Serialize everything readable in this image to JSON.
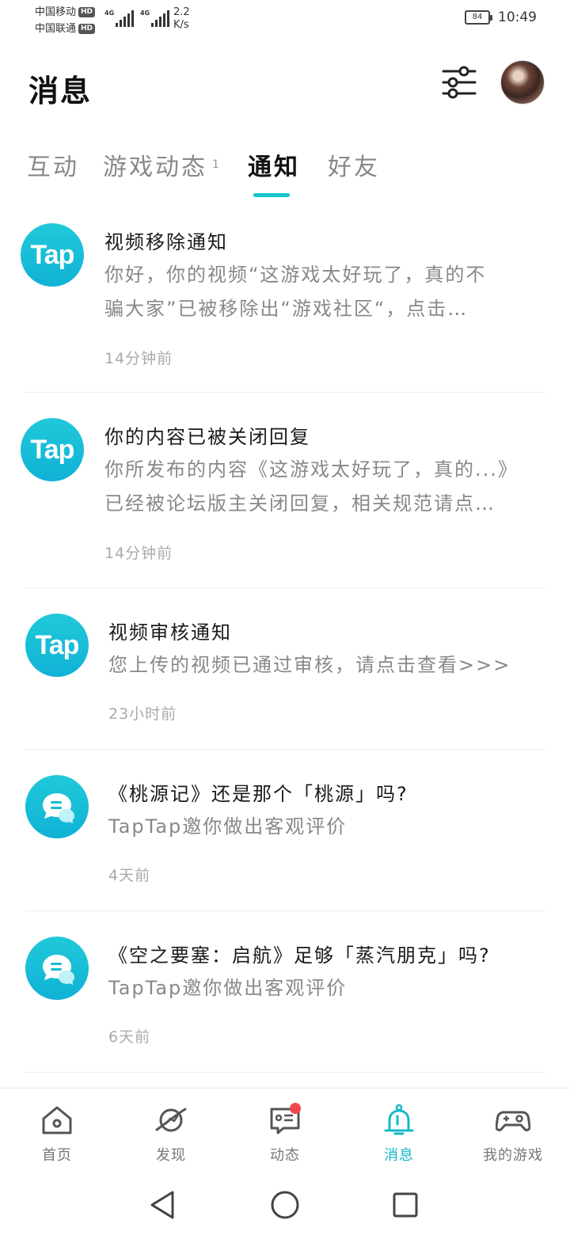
{
  "status_bar": {
    "carrier1": "中国移动",
    "carrier2": "中国联通",
    "hd": "HD",
    "net1": "4G",
    "net2": "4G",
    "speed_value": "2.2",
    "speed_unit": "K/s",
    "battery": "84",
    "time": "10:49"
  },
  "header": {
    "title": "消息",
    "filter_icon": "sliders-icon",
    "avatar": "user-avatar"
  },
  "tabs": [
    {
      "label": "互动",
      "active": false
    },
    {
      "label": "游戏动态",
      "active": false,
      "badge": "1"
    },
    {
      "label": "通知",
      "active": true
    },
    {
      "label": "好友",
      "active": false
    }
  ],
  "notifications": [
    {
      "icon": "tap-logo",
      "icon_text": "Tap",
      "title": "视频移除通知",
      "body_lines": [
        "你好，你的视频“这游戏太好玩了，真的不",
        "骗大家”已被移除出“游戏社区“，点击…"
      ],
      "time": "14分钟前"
    },
    {
      "icon": "tap-logo",
      "icon_text": "Tap",
      "title": "你的内容已被关闭回复",
      "body_lines": [
        "你所发布的内容《这游戏太好玩了，真的...》",
        "已经被论坛版主关闭回复，相关规范请点…"
      ],
      "time": "14分钟前"
    },
    {
      "icon": "tap-logo",
      "icon_text": "Tap",
      "title": "视频审核通知",
      "body_lines": [
        "您上传的视频已通过审核，请点击查看>>>"
      ],
      "time": "23小时前"
    },
    {
      "icon": "chat-bubble-icon",
      "title": "《桃源记》还是那个「桃源」吗?",
      "body_lines": [
        "TapTap邀你做出客观评价"
      ],
      "time": "4天前"
    },
    {
      "icon": "chat-bubble-icon",
      "title": "《空之要塞：启航》足够「蒸汽朋克」吗?",
      "body_lines": [
        "TapTap邀你做出客观评价"
      ],
      "time": "6天前"
    }
  ],
  "bottom_nav": [
    {
      "label": "首页",
      "icon": "home-icon",
      "active": false
    },
    {
      "label": "发现",
      "icon": "discover-planet-icon",
      "active": false
    },
    {
      "label": "动态",
      "icon": "feed-icon",
      "active": false,
      "has_dot": true
    },
    {
      "label": "消息",
      "icon": "bell-icon",
      "active": true
    },
    {
      "label": "我的游戏",
      "icon": "gamepad-icon",
      "active": false
    }
  ],
  "colors": {
    "accent": "#14c4c8",
    "badge_red": "#f04848"
  }
}
